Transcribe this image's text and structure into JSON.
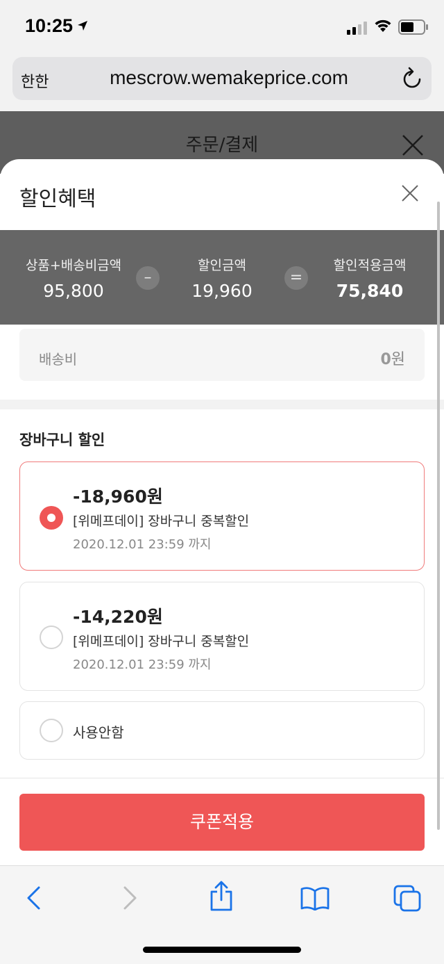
{
  "status": {
    "time": "10:25"
  },
  "browser": {
    "aa_label": "한한",
    "url": "mescrow.wemakeprice.com"
  },
  "background_page": {
    "title": "주문/결제"
  },
  "sheet": {
    "title": "할인혜택",
    "summary": {
      "product_label": "상품+배송비금액",
      "product_value": "95,800",
      "minus_symbol": "–",
      "discount_label": "할인금액",
      "discount_value": "19,960",
      "equals_symbol": "=",
      "final_label": "할인적용금액",
      "final_value": "75,840"
    },
    "shipping": {
      "label": "배송비",
      "value": "0",
      "unit": "원"
    },
    "section_title": "장바구니 할인",
    "coupons": [
      {
        "amount": "-18,960원",
        "name": "[위메프데이] 장바구니 중복할인",
        "expiry": "2020.12.01 23:59 까지",
        "selected": true
      },
      {
        "amount": "-14,220원",
        "name": "[위메프데이] 장바구니 중복할인",
        "expiry": "2020.12.01 23:59 까지",
        "selected": false
      }
    ],
    "no_use_label": "사용안함",
    "apply_label": "쿠폰적용"
  },
  "colors": {
    "accent": "#ef5656",
    "summary_bg": "#666666",
    "toolbar_icon": "#1a73e8"
  },
  "icons": [
    "location-arrow-icon",
    "signal-icon",
    "wifi-icon",
    "battery-icon",
    "reload-icon",
    "close-icon",
    "back-icon",
    "forward-icon",
    "share-icon",
    "bookmarks-icon",
    "tabs-icon"
  ]
}
